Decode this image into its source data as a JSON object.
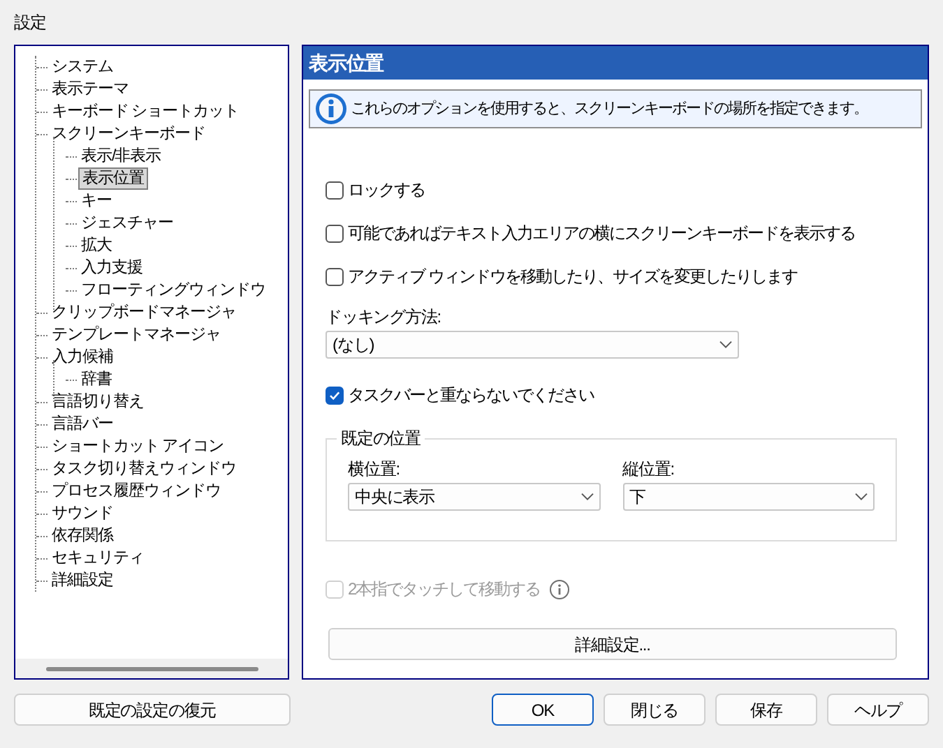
{
  "window": {
    "title": "設定"
  },
  "sidebar": {
    "items": [
      {
        "label": "システム",
        "selected": false
      },
      {
        "label": "表示テーマ",
        "selected": false
      },
      {
        "label": "キーボード ショートカット",
        "selected": false
      },
      {
        "label": "スクリーンキーボード",
        "selected": false,
        "children": [
          {
            "label": "表示/非表示",
            "selected": false
          },
          {
            "label": "表示位置",
            "selected": true
          },
          {
            "label": "キー",
            "selected": false
          },
          {
            "label": "ジェスチャー",
            "selected": false
          },
          {
            "label": "拡大",
            "selected": false
          },
          {
            "label": "入力支援",
            "selected": false
          },
          {
            "label": "フローティングウィンドウ",
            "selected": false
          }
        ]
      },
      {
        "label": "クリップボードマネージャ",
        "selected": false
      },
      {
        "label": "テンプレートマネージャ",
        "selected": false
      },
      {
        "label": "入力候補",
        "selected": false,
        "children": [
          {
            "label": "辞書",
            "selected": false
          }
        ]
      },
      {
        "label": "言語切り替え",
        "selected": false
      },
      {
        "label": "言語バー",
        "selected": false
      },
      {
        "label": "ショートカット アイコン",
        "selected": false
      },
      {
        "label": "タスク切り替えウィンドウ",
        "selected": false
      },
      {
        "label": "プロセス履歴ウィンドウ",
        "selected": false
      },
      {
        "label": "サウンド",
        "selected": false
      },
      {
        "label": "依存関係",
        "selected": false
      },
      {
        "label": "セキュリティ",
        "selected": false
      },
      {
        "label": "詳細設定",
        "selected": false
      }
    ]
  },
  "panel": {
    "title": "表示位置",
    "info": "これらのオプションを使用すると、スクリーンキーボードの場所を指定できます。",
    "options": [
      {
        "label": "ロックする",
        "checked": false
      },
      {
        "label": "可能であればテキスト入力エリアの横にスクリーンキーボードを表示する",
        "checked": false
      },
      {
        "label": "アクティブ ウィンドウを移動したり、サイズを変更したりします",
        "checked": false
      }
    ],
    "docking": {
      "label": "ドッキング方法:",
      "value": "(なし)"
    },
    "taskbar_option": {
      "label": "タスクバーと重ならないでください",
      "checked": true
    },
    "default_position": {
      "title": "既定の位置",
      "fields": [
        {
          "label": "横位置:",
          "value": "中央に表示"
        },
        {
          "label": "縦位置:",
          "value": "下"
        }
      ]
    },
    "touch_option": {
      "label": "2本指でタッチして移動する",
      "checked": false,
      "disabled": true
    },
    "advanced_button": "詳細設定..."
  },
  "buttons": {
    "restore": "既定の設定の復元",
    "actions": [
      {
        "label": "OK",
        "default": true
      },
      {
        "label": "閉じる",
        "default": false
      },
      {
        "label": "保存",
        "default": false
      },
      {
        "label": "ヘルプ",
        "default": false
      }
    ]
  }
}
